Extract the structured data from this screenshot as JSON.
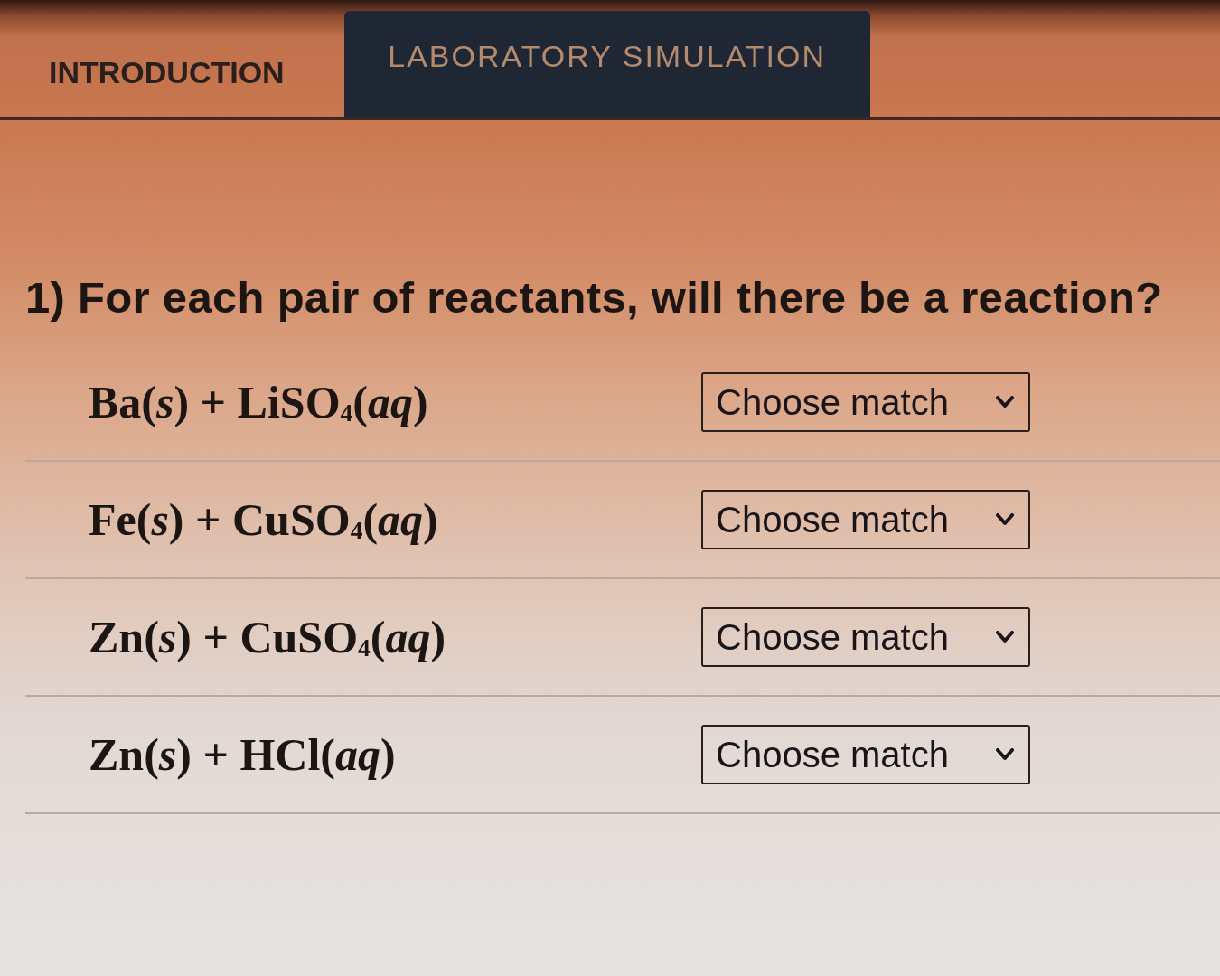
{
  "tabs": [
    {
      "label": "INTRODUCTION",
      "selected": false
    },
    {
      "label": "LABORATORY SIMULATION",
      "selected": true
    }
  ],
  "question": {
    "text": "1) For each pair of reactants, will there be a reaction?"
  },
  "rows": [
    {
      "reactants": "Ba(*s*) + LiSO$_{4}$(*aq*)",
      "dropdown": "Choose match"
    },
    {
      "reactants": "Fe(*s*) + CuSO$_{4}$(*aq*)",
      "dropdown": "Choose match"
    },
    {
      "reactants": "Zn(*s*) + CuSO$_{4}$(*aq*)",
      "dropdown": "Choose match"
    },
    {
      "reactants": "Zn(*s*) + HCl(*aq*)",
      "dropdown": "Choose match"
    }
  ]
}
